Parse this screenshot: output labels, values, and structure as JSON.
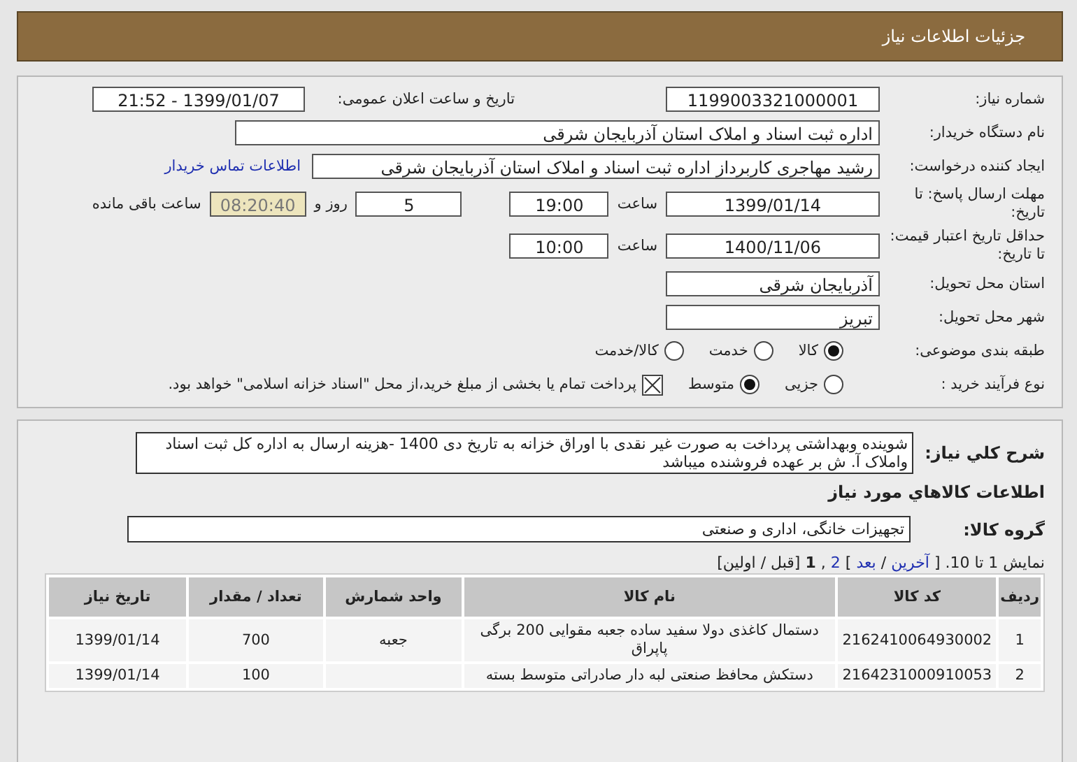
{
  "header": {
    "title": "جزئیات اطلاعات نیاز"
  },
  "details": {
    "need_number": {
      "label": "شماره نیاز:",
      "value": "1199003321000001"
    },
    "announce": {
      "label": "تاریخ و ساعت اعلان عمومی:",
      "value": "1399/01/07 - 21:52"
    },
    "buyer": {
      "label": "نام دستگاه خریدار:",
      "value": "اداره ثبت اسناد و املاک استان آذربایجان شرقی"
    },
    "creator": {
      "label": "ایجاد کننده درخواست:",
      "value": "رشید مهاجری کاربرداز اداره ثبت اسناد و املاک استان آذربایجان شرقی",
      "link": "اطلاعات تماس خریدار"
    },
    "deadline": {
      "label": "مهلت ارسال پاسخ: تا تاریخ:",
      "date": "1399/01/14",
      "time_label": "ساعت",
      "time": "19:00",
      "days": "5",
      "days_label": "روز و",
      "remaining": "08:20:40",
      "remaining_label": "ساعت باقی مانده"
    },
    "validity": {
      "label": "حداقل تاریخ اعتبار قیمت: تا تاریخ:",
      "date": "1400/11/06",
      "time_label": "ساعت",
      "time": "10:00"
    },
    "province": {
      "label": "استان محل تحویل:",
      "value": "آذربایجان شرقی"
    },
    "city": {
      "label": "شهر محل تحویل:",
      "value": "تبریز"
    },
    "category": {
      "label": "طبقه بندی موضوعی:",
      "options": [
        {
          "label": "کالا",
          "selected": true
        },
        {
          "label": "خدمت",
          "selected": false
        },
        {
          "label": "کالا/خدمت",
          "selected": false
        }
      ]
    },
    "process": {
      "label": "نوع فرآیند خرید :",
      "options": [
        {
          "label": "جزیی",
          "selected": false
        },
        {
          "label": "متوسط",
          "selected": true
        }
      ],
      "payment": {
        "checked": true,
        "text": "پرداخت تمام یا بخشی از مبلغ خرید،از محل \"اسناد خزانه اسلامی\" خواهد بود."
      }
    }
  },
  "description": {
    "label": "شرح کلي نياز:",
    "text": "شوینده وبهداشتی پرداخت به صورت غیر نقدی با اوراق خزانه به تاریخ دی 1400 -هزینه ارسال به اداره کل ثبت اسناد واملاک  آ. ش بر عهده فروشنده میباشد"
  },
  "goods_title": "اطلاعات کالاهاي مورد نياز",
  "goods_group": {
    "label": "گروه کالا:",
    "value": "تجهیزات خانگی، اداری و صنعتی"
  },
  "pagination": [
    {
      "kind": "text",
      "label": "نمایش 1 تا 10. ["
    },
    {
      "kind": "link",
      "label": "آخرین"
    },
    {
      "kind": "text",
      "label": "/"
    },
    {
      "kind": "link",
      "label": "بعد"
    },
    {
      "kind": "text",
      "label": "]"
    },
    {
      "kind": "link",
      "label": "2"
    },
    {
      "kind": "text",
      "label": ","
    },
    {
      "kind": "current",
      "label": "1"
    },
    {
      "kind": "text",
      "label": "[قبل / اولین]"
    }
  ],
  "table": {
    "columns": [
      "ردیف",
      "کد کالا",
      "نام کالا",
      "واحد شمارش",
      "تعداد / مقدار",
      "تاریخ نیاز"
    ],
    "rows": [
      [
        "1",
        "2162410064930002",
        "دستمال کاغذی دولا سفید ساده جعبه مقوایی 200 برگی پاپراق",
        "جعبه",
        "700",
        "1399/01/14"
      ],
      [
        "2",
        "2164231000910053",
        "دستکش محافظ صنعتی لبه دار صادراتی متوسط بسته",
        "",
        "100",
        "1399/01/14"
      ]
    ]
  }
}
